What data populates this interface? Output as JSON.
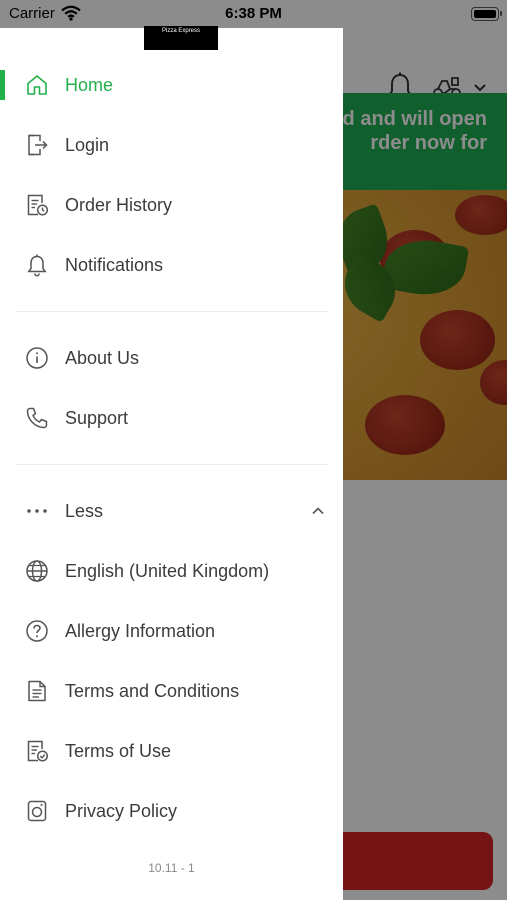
{
  "status_bar": {
    "carrier": "Carrier",
    "time": "6:38 PM"
  },
  "background": {
    "banner_line_1": "ed and will open",
    "banner_line_2": "rder now for"
  },
  "drawer": {
    "logo_text": "Pizza Express",
    "active_item": "Home",
    "accent_color": "#22b04b",
    "section_main": [
      {
        "label": "Home",
        "icon": "home-icon"
      },
      {
        "label": "Login",
        "icon": "login-icon"
      },
      {
        "label": "Order History",
        "icon": "order-history-icon"
      },
      {
        "label": "Notifications",
        "icon": "bell-icon"
      }
    ],
    "section_info": [
      {
        "label": "About Us",
        "icon": "info-icon"
      },
      {
        "label": "Support",
        "icon": "phone-icon"
      }
    ],
    "section_more": {
      "toggle_label": "Less",
      "items": [
        {
          "label": "English (United Kingdom)",
          "icon": "globe-icon"
        },
        {
          "label": "Allergy Information",
          "icon": "question-icon"
        },
        {
          "label": "Terms and Conditions",
          "icon": "document-icon"
        },
        {
          "label": "Terms of Use",
          "icon": "document-check-icon"
        },
        {
          "label": "Privacy Policy",
          "icon": "privacy-icon"
        }
      ]
    },
    "version": "10.11 - 1"
  }
}
